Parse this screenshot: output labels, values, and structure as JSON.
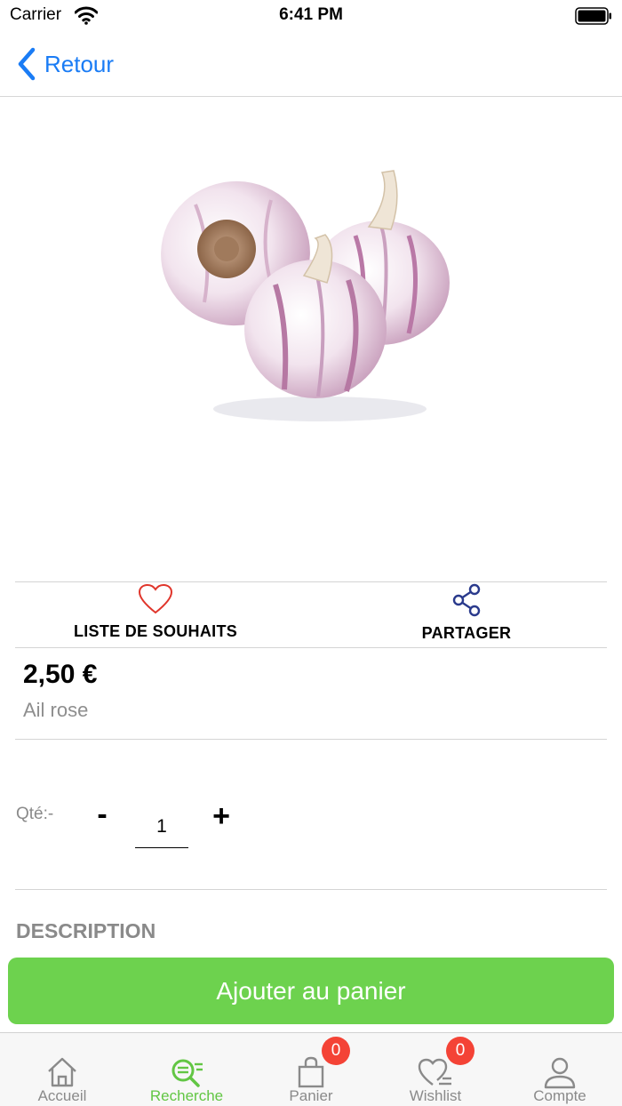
{
  "status_bar": {
    "carrier": "Carrier",
    "time": "6:41 PM"
  },
  "nav": {
    "back_label": "Retour"
  },
  "product": {
    "image_icon": "garlic-bulbs-photo",
    "price": "2,50 €",
    "name": "Ail rose"
  },
  "actions": {
    "wishlist_label": "LISTE DE SOUHAITS",
    "share_label": "PARTAGER",
    "wishlist_color": "#e0352b",
    "share_color": "#2a3a8c"
  },
  "quantity": {
    "label": "Qté:-",
    "minus": "-",
    "value": "1",
    "plus": "+"
  },
  "description": {
    "title": "DESCRIPTION"
  },
  "add_to_cart": {
    "label": "Ajouter au panier",
    "color": "#6dd24e"
  },
  "tab_bar": {
    "active_color": "#62c644",
    "items": [
      {
        "label": "Accueil",
        "icon": "home-icon"
      },
      {
        "label": "Recherche",
        "icon": "search-list-icon",
        "active": true
      },
      {
        "label": "Panier",
        "icon": "bag-icon",
        "badge": "0"
      },
      {
        "label": "Wishlist",
        "icon": "heart-list-icon",
        "badge": "0"
      },
      {
        "label": "Compte",
        "icon": "user-icon"
      }
    ]
  }
}
